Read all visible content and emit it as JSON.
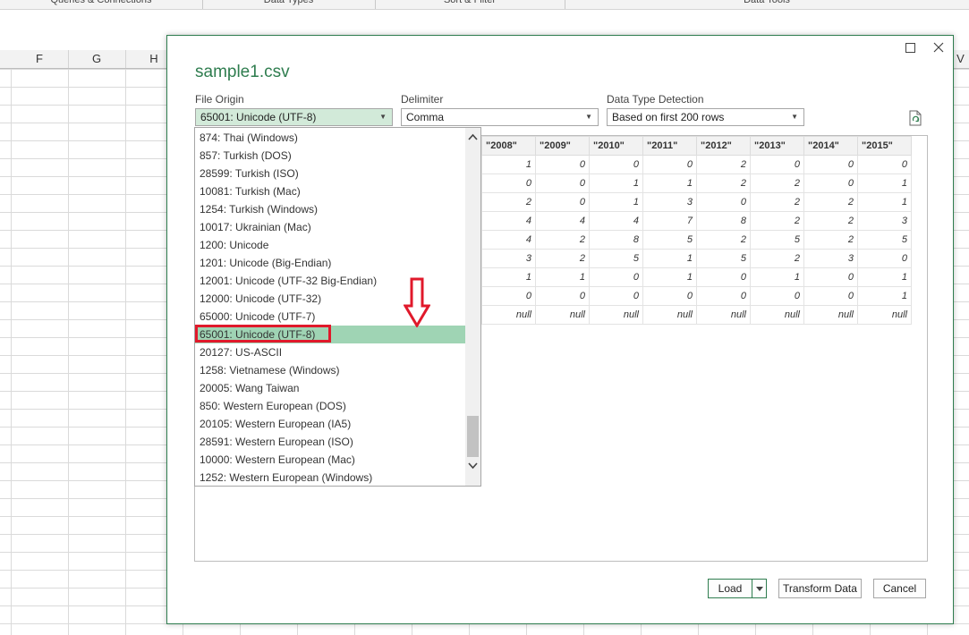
{
  "ribbon": {
    "groups": [
      "Queries & Connections",
      "Data Types",
      "Sort & Filter",
      "Data Tools"
    ]
  },
  "sheet": {
    "columns": [
      "F",
      "G",
      "H",
      "V"
    ]
  },
  "dialog": {
    "title": "sample1.csv",
    "file_origin": {
      "label": "File Origin",
      "value": "65001: Unicode (UTF-8)",
      "options": [
        "874: Thai (Windows)",
        "857: Turkish (DOS)",
        "28599: Turkish (ISO)",
        "10081: Turkish (Mac)",
        "1254: Turkish (Windows)",
        "10017: Ukrainian (Mac)",
        "1200: Unicode",
        "1201: Unicode (Big-Endian)",
        "12001: Unicode (UTF-32 Big-Endian)",
        "12000: Unicode (UTF-32)",
        "65000: Unicode (UTF-7)",
        "65001: Unicode (UTF-8)",
        "20127: US-ASCII",
        "1258: Vietnamese (Windows)",
        "20005: Wang Taiwan",
        "850: Western European (DOS)",
        "20105: Western European (IA5)",
        "28591: Western European (ISO)",
        "10000: Western European (Mac)",
        "1252: Western European (Windows)"
      ],
      "selected_index": 11
    },
    "delimiter": {
      "label": "Delimiter",
      "value": "Comma"
    },
    "detection": {
      "label": "Data Type Detection",
      "value": "Based on first 200 rows"
    },
    "preview": {
      "headers": [
        "\"2008\"",
        "\"2009\"",
        "\"2010\"",
        "\"2011\"",
        "\"2012\"",
        "\"2013\"",
        "\"2014\"",
        "\"2015\""
      ],
      "rows": [
        [
          "1",
          "0",
          "0",
          "0",
          "2",
          "0",
          "0",
          "0"
        ],
        [
          "0",
          "0",
          "1",
          "1",
          "2",
          "2",
          "0",
          "1"
        ],
        [
          "2",
          "0",
          "1",
          "3",
          "0",
          "2",
          "2",
          "1"
        ],
        [
          "4",
          "4",
          "4",
          "7",
          "8",
          "2",
          "2",
          "3"
        ],
        [
          "4",
          "2",
          "8",
          "5",
          "2",
          "5",
          "2",
          "5"
        ],
        [
          "3",
          "2",
          "5",
          "1",
          "5",
          "2",
          "3",
          "0"
        ],
        [
          "1",
          "1",
          "0",
          "1",
          "0",
          "1",
          "0",
          "1"
        ],
        [
          "0",
          "0",
          "0",
          "0",
          "0",
          "0",
          "0",
          "1"
        ],
        [
          "null",
          "null",
          "null",
          "null",
          "null",
          "null",
          "null",
          "null"
        ]
      ]
    },
    "buttons": {
      "load": "Load",
      "transform": "Transform Data",
      "cancel": "Cancel"
    },
    "colors": {
      "accent": "#2f7d4f",
      "selected_item": "#9fd4b4",
      "annotation": "#e0192b"
    }
  }
}
